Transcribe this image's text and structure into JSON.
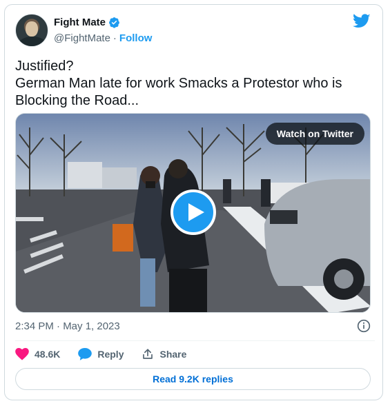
{
  "author": {
    "name": "Fight Mate",
    "handle": "@FightMate",
    "separator": "·",
    "follow_label": "Follow"
  },
  "tweet": {
    "text_line1": "Justified?",
    "text_line2": "German Man late for work Smacks a Protestor who is Blocking the Road..."
  },
  "media": {
    "watch_label": "Watch on Twitter"
  },
  "meta": {
    "timestamp": "2:34 PM · May 1, 2023"
  },
  "actions": {
    "likes": "48.6K",
    "reply_label": "Reply",
    "share_label": "Share"
  },
  "footer": {
    "read_replies_label": "Read 9.2K replies"
  },
  "colors": {
    "accent": "#1d9bf0",
    "like": "#f91880",
    "text_secondary": "#536471"
  },
  "icons": [
    "verified-badge-icon",
    "twitter-bird-icon",
    "play-icon",
    "info-icon",
    "heart-icon",
    "reply-bubble-icon",
    "share-icon"
  ]
}
